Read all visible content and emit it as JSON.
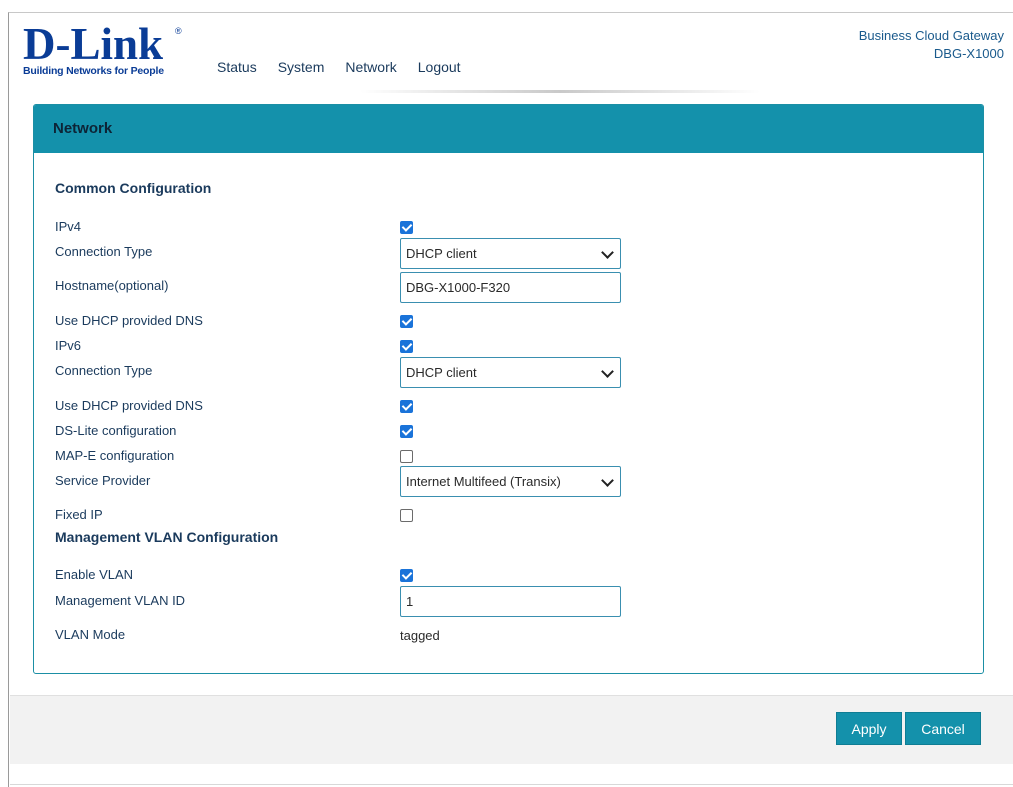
{
  "header": {
    "logo_main": "D-Link",
    "logo_reg": "®",
    "logo_tagline": "Building Networks for People",
    "nav": [
      "Status",
      "System",
      "Network",
      "Logout"
    ],
    "brand_line1": "Business Cloud Gateway",
    "brand_line2": "DBG-X1000"
  },
  "panel": {
    "title": "Network",
    "common_title": "Common Configuration",
    "ipv4_label": "IPv4",
    "ipv4_checked": true,
    "conn_type_label_v4": "Connection Type",
    "conn_type_v4": "DHCP client",
    "hostname_label": "Hostname(optional)",
    "hostname_value": "DBG-X1000-F320",
    "dns_v4_label": "Use DHCP provided DNS",
    "dns_v4_checked": true,
    "ipv6_label": "IPv6",
    "ipv6_checked": true,
    "conn_type_label_v6": "Connection Type",
    "conn_type_v6": "DHCP client",
    "dns_v6_label": "Use DHCP provided DNS",
    "dns_v6_checked": true,
    "dslite_label": "DS-Lite configuration",
    "dslite_checked": true,
    "mape_label": "MAP-E configuration",
    "mape_checked": false,
    "provider_label": "Service Provider",
    "provider_value": "Internet Multifeed (Transix)",
    "fixedip_label": "Fixed IP",
    "fixedip_checked": false,
    "vlan_title": "Management VLAN Configuration",
    "enable_vlan_label": "Enable VLAN",
    "enable_vlan_checked": true,
    "vlan_id_label": "Management VLAN ID",
    "vlan_id_value": "1",
    "vlan_mode_label": "VLAN Mode",
    "vlan_mode_value": "tagged"
  },
  "footer": {
    "apply_label": "Apply",
    "cancel_label": "Cancel"
  },
  "colors": {
    "accent": "#1491ab",
    "logo": "#0a3c96",
    "checkbox": "#1a73d9"
  }
}
